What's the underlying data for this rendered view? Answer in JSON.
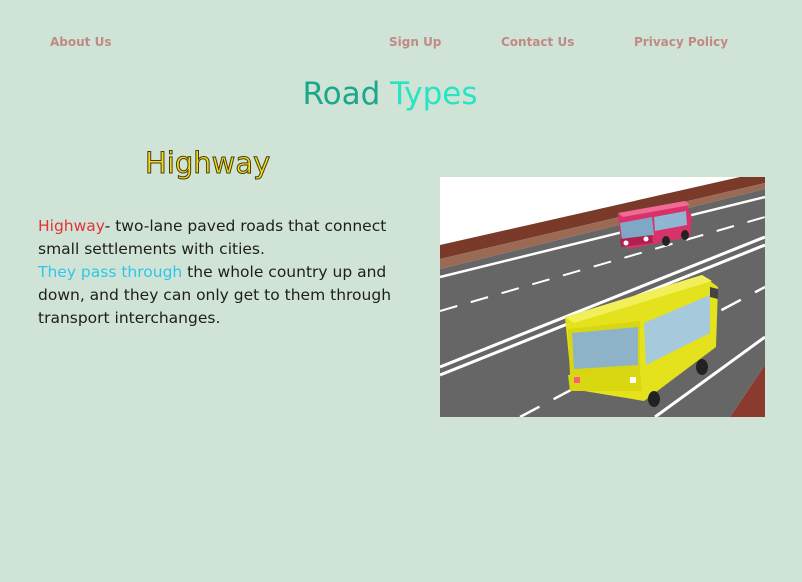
{
  "nav": {
    "about": "About Us",
    "signup": "Sign Up",
    "contact": "Contact Us",
    "privacy": "Privacy Policy"
  },
  "page_title": {
    "word1": "Road",
    "word2": "Types"
  },
  "section": {
    "title": "Highway",
    "desc": {
      "term": "Highway",
      "part1": "- two-lane paved roads that connect small settlements with cities.",
      "highlight": "They pass through",
      "part2": " the whole country up and down, and they can only get to them through transport interchanges."
    }
  },
  "colors": {
    "background": "#cfe3d7",
    "nav_link": "#c08a86",
    "title_word1": "#1aa88a",
    "title_word2": "#25e5c2",
    "section_title": "#f0de1e",
    "term_red": "#e53232",
    "highlight_cyan": "#2ec8e6"
  }
}
